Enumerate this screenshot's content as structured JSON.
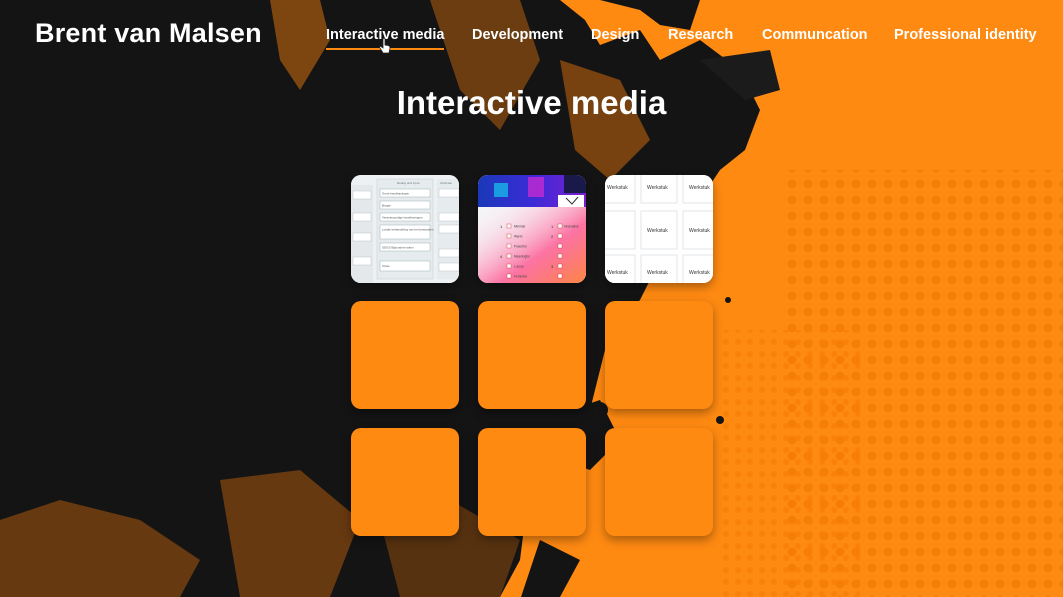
{
  "header": {
    "site_title": "Brent van Malsen",
    "nav": [
      {
        "label": "Interactive media",
        "active": true
      },
      {
        "label": "Development",
        "active": false
      },
      {
        "label": "Design",
        "active": false
      },
      {
        "label": "Research",
        "active": false
      },
      {
        "label": "Communcation",
        "active": false
      },
      {
        "label": "Professional identity",
        "active": false
      }
    ]
  },
  "main": {
    "heading": "Interactive media"
  },
  "thumb1": {
    "left_col": [
      "",
      "",
      "",
      "",
      ""
    ],
    "middle_header": "Reality and Input",
    "middle_items": [
      "Grote handhavingen",
      "Borgte",
      "Verantwoordige handhavingen",
      "Lokale behandeling van het bestanden",
      "SDGS Bijzondere taken"
    ],
    "middle_footer": "Close",
    "right_header": "Optimale",
    "right_items": [
      "",
      "",
      "",
      "",
      ""
    ]
  },
  "thumb2": {
    "rows": [
      {
        "num_a": "1",
        "label": "Minimal",
        "num_b": "1",
        "right": "Innovative"
      },
      {
        "num_a": "",
        "label": "Warm",
        "num_b": "2",
        "right": ""
      },
      {
        "num_a": "",
        "label": "Powerful",
        "num_b": "",
        "right": ""
      },
      {
        "num_a": "4",
        "label": "Meaningful",
        "num_b": "",
        "right": ""
      },
      {
        "num_a": "",
        "label": "Luxury",
        "num_b": "3",
        "right": ""
      },
      {
        "num_a": "",
        "label": "Feminine",
        "num_b": "",
        "right": ""
      }
    ]
  },
  "thumb3": {
    "cells": [
      "Werkstuk",
      "Werkstuk",
      "Werkstuk",
      "",
      "Werkstuk",
      "Werkstuk",
      "Werkstuk",
      "Werkstuk",
      "Werkstuk"
    ]
  },
  "colors": {
    "orange": "#ff8a12",
    "black": "#141414",
    "white": "#ffffff"
  },
  "icons": {
    "cursor": "hand-pointer-icon"
  }
}
